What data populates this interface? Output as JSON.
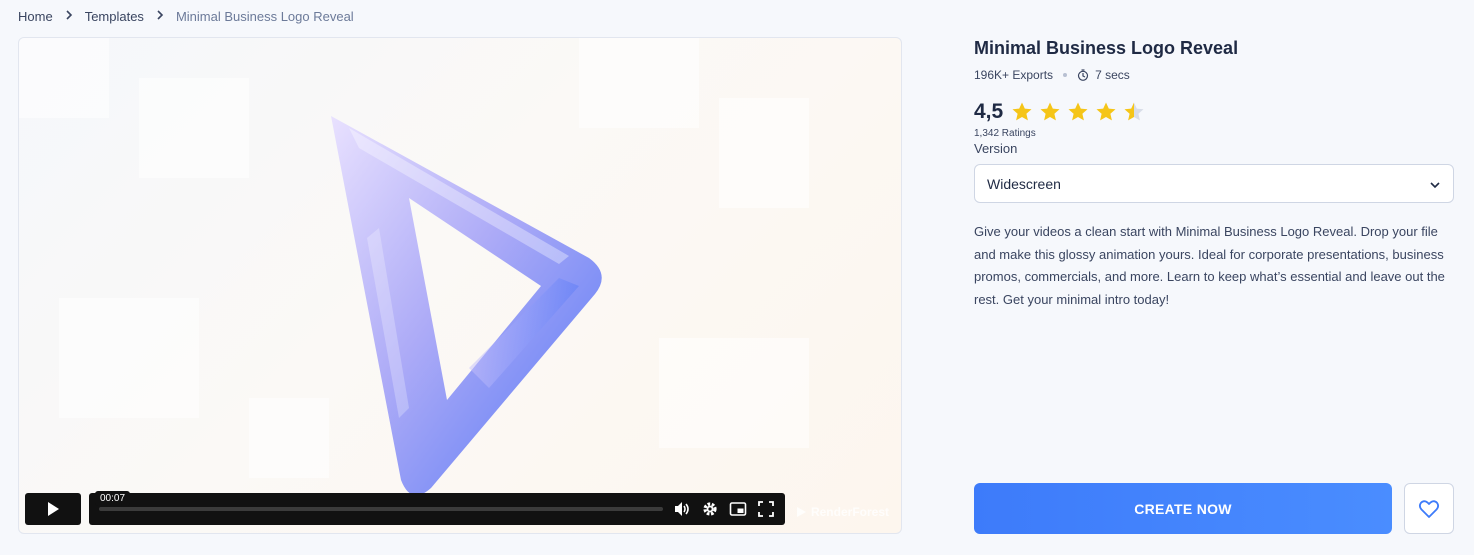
{
  "breadcrumb": {
    "home": "Home",
    "templates": "Templates",
    "current": "Minimal Business Logo Reveal"
  },
  "player": {
    "current_time": "00:07",
    "progress_fraction": 0.0,
    "watermark": "RenderForest"
  },
  "product": {
    "title": "Minimal Business Logo Reveal",
    "exports": "196K+ Exports",
    "duration": "7 secs",
    "rating": "4,5",
    "rating_stars": 4.5,
    "ratings_count": "1,342 Ratings",
    "version_label": "Version",
    "version_selected": "Widescreen",
    "description": "Give your videos a clean start with Minimal Business Logo Reveal. Drop your file and make this glossy animation yours. Ideal for corporate presentations, business promos, commercials, and more. Learn to keep what’s essential and leave out the rest. Get your minimal intro today!"
  },
  "actions": {
    "create_label": "CREATE NOW"
  },
  "colors": {
    "accent": "#3d7bfa",
    "star": "#f5c518",
    "star_empty": "#d8dde8"
  },
  "icons": [
    "chevron-right-icon",
    "play-icon",
    "volume-icon",
    "gear-icon",
    "pip-icon",
    "fullscreen-icon",
    "timer-icon",
    "star-icon",
    "chevron-down-icon",
    "heart-icon"
  ]
}
